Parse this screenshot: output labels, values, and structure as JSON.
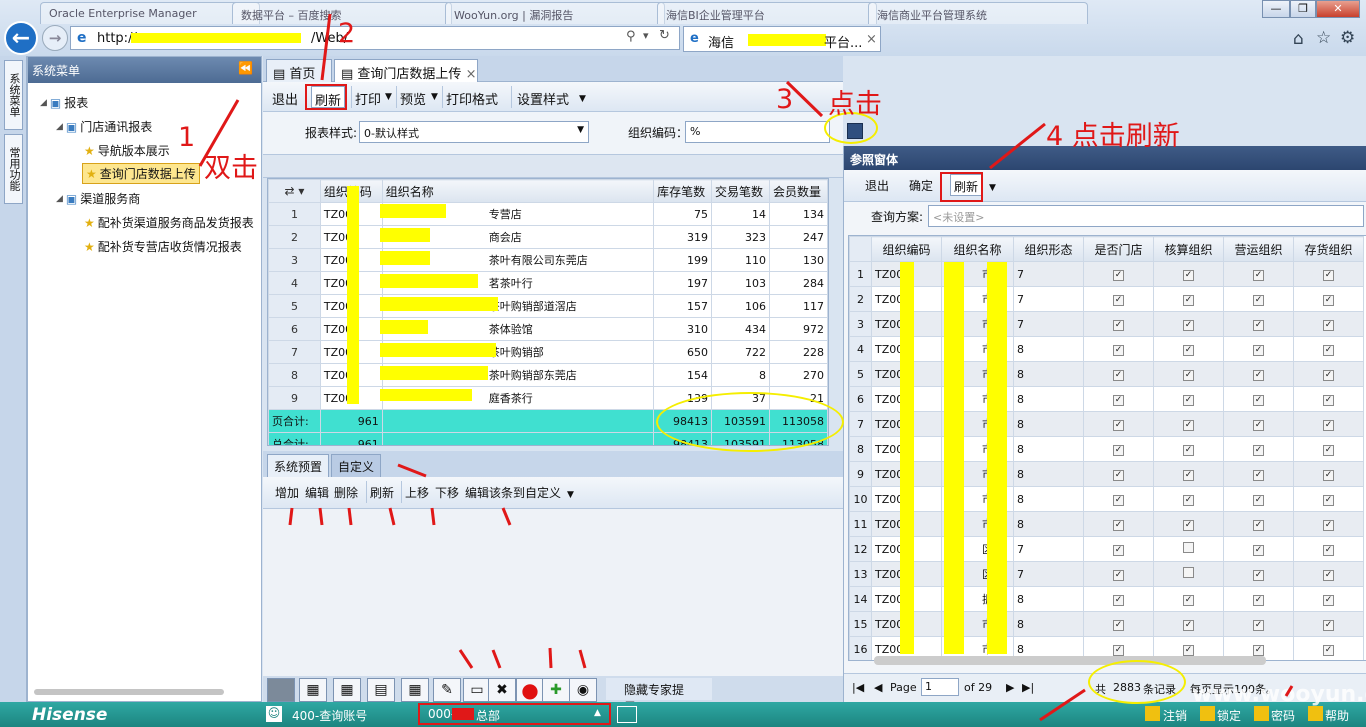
{
  "browser": {
    "tabs": [
      "Oracle Enterprise Manager",
      "数据平台 – 百度搜索",
      "WooYun.org | 漏洞报告",
      "海信BI企业管理平台",
      "海信商业平台管理系统"
    ],
    "address": "http://",
    "address_suffix": "/Web/",
    "active_tab": "海信",
    "active_tab_suffix": "平台...",
    "window_buttons": [
      "—",
      "❐",
      "✕"
    ]
  },
  "side_tabs": [
    "系统菜单",
    "常用功能"
  ],
  "left_panel": {
    "title": "系统菜单",
    "tree": [
      {
        "label": "报表",
        "level": 0
      },
      {
        "label": "门店通讯报表",
        "level": 1
      },
      {
        "label": "导航版本展示",
        "level": 2
      },
      {
        "label": "查询门店数据上传",
        "level": 2
      },
      {
        "label": "渠道服务商",
        "level": 1
      },
      {
        "label": "配补货渠道服务商品发货报表",
        "level": 2
      },
      {
        "label": "配补货专营店收货情况报表",
        "level": 2
      }
    ]
  },
  "main_tabs": [
    "首页",
    "查询门店数据上传"
  ],
  "toolbar": {
    "exit": "退出",
    "refresh": "刷新",
    "print": "打印",
    "preview": "预览",
    "print_format": "打印格式",
    "set_style": "设置样式"
  },
  "filter": {
    "style_label": "报表样式:",
    "style_value": "0-默认样式",
    "org_label": "组织编码：",
    "org_value": "%"
  },
  "report": {
    "columns": [
      "组织编码",
      "组织名称",
      "库存笔数",
      "交易笔数",
      "会员数量"
    ],
    "rows": [
      {
        "no": "1",
        "code": "TZ000",
        "name": "专营店",
        "stock": "75",
        "trade": "14",
        "member": "134"
      },
      {
        "no": "2",
        "code": "TZ000",
        "name": "商会店",
        "stock": "319",
        "trade": "323",
        "member": "247"
      },
      {
        "no": "3",
        "code": "TZ000",
        "name": "茶叶有限公司东莞店",
        "stock": "199",
        "trade": "110",
        "member": "130"
      },
      {
        "no": "4",
        "code": "TZ000",
        "name": "茗茶叶行",
        "stock": "197",
        "trade": "103",
        "member": "284"
      },
      {
        "no": "5",
        "code": "TZ000",
        "name": "茶叶购销部道滘店",
        "stock": "157",
        "trade": "106",
        "member": "117"
      },
      {
        "no": "6",
        "code": "TZ000",
        "name": "茶体验馆",
        "stock": "310",
        "trade": "434",
        "member": "972"
      },
      {
        "no": "7",
        "code": "TZ000",
        "name": "茶叶购销部",
        "stock": "650",
        "trade": "722",
        "member": "228"
      },
      {
        "no": "8",
        "code": "TZ000",
        "name": "茶叶购销部东莞店",
        "stock": "154",
        "trade": "8",
        "member": "270"
      },
      {
        "no": "9",
        "code": "TZ000",
        "name": "庭香茶行",
        "stock": "139",
        "trade": "37",
        "member": "21"
      }
    ],
    "page_total": {
      "label": "页合计:",
      "count": "961",
      "stock": "98413",
      "trade": "103591",
      "member": "113058"
    },
    "grand_total": {
      "label": "总合计:",
      "count": "961",
      "stock": "98413",
      "trade": "103591",
      "member": "113058"
    }
  },
  "lower": {
    "tabs": [
      "系统预置",
      "自定义"
    ],
    "buttons": [
      "增加",
      "编辑",
      "删除",
      "刷新",
      "上移",
      "下移",
      "编辑该条到自定义"
    ],
    "hide_expert": "隐藏专家提示"
  },
  "ref_window": {
    "title": "参照窗体",
    "buttons": [
      "退出",
      "确定",
      "刷新"
    ],
    "query_label": "查询方案:",
    "query_placeholder": "<未设置>",
    "columns": [
      "组织编码",
      "组织名称",
      "组织形态",
      "是否门店",
      "核算组织",
      "营运组织",
      "存货组织"
    ],
    "rows": [
      {
        "no": "1",
        "code": "TZ00",
        "name": "市",
        "form": "7",
        "checks": [
          true,
          true,
          true,
          true
        ]
      },
      {
        "no": "2",
        "code": "TZ00",
        "name": "市",
        "form": "7",
        "checks": [
          true,
          true,
          true,
          true
        ]
      },
      {
        "no": "3",
        "code": "TZ00",
        "name": "市",
        "form": "7",
        "checks": [
          true,
          true,
          true,
          true
        ]
      },
      {
        "no": "4",
        "code": "TZ00",
        "name": "市",
        "form": "8",
        "checks": [
          true,
          true,
          true,
          true
        ]
      },
      {
        "no": "5",
        "code": "TZ00",
        "name": "市",
        "form": "8",
        "checks": [
          true,
          true,
          true,
          true
        ]
      },
      {
        "no": "6",
        "code": "TZ00",
        "name": "市",
        "form": "8",
        "checks": [
          true,
          true,
          true,
          true
        ]
      },
      {
        "no": "7",
        "code": "TZ00",
        "name": "市",
        "form": "8",
        "checks": [
          true,
          true,
          true,
          true
        ]
      },
      {
        "no": "8",
        "code": "TZ00",
        "name": "市",
        "form": "8",
        "checks": [
          true,
          true,
          true,
          true
        ]
      },
      {
        "no": "9",
        "code": "TZ00",
        "name": "市",
        "form": "8",
        "checks": [
          true,
          true,
          true,
          true
        ]
      },
      {
        "no": "10",
        "code": "TZ00",
        "name": "市",
        "form": "8",
        "checks": [
          true,
          true,
          true,
          true
        ]
      },
      {
        "no": "11",
        "code": "TZ00",
        "name": "市",
        "form": "8",
        "checks": [
          true,
          true,
          true,
          true
        ]
      },
      {
        "no": "12",
        "code": "TZ00",
        "name": "区",
        "form": "7",
        "checks": [
          true,
          false,
          true,
          true
        ]
      },
      {
        "no": "13",
        "code": "TZ00",
        "name": "区",
        "form": "7",
        "checks": [
          true,
          false,
          true,
          true
        ]
      },
      {
        "no": "14",
        "code": "TZ00",
        "name": "振",
        "form": "8",
        "checks": [
          true,
          true,
          true,
          true
        ]
      },
      {
        "no": "15",
        "code": "TZ00",
        "name": "市",
        "form": "8",
        "checks": [
          true,
          true,
          true,
          true
        ]
      },
      {
        "no": "16",
        "code": "TZ00",
        "name": "市",
        "form": "8",
        "checks": [
          true,
          true,
          true,
          true
        ]
      }
    ],
    "pager": {
      "page_label": "Page",
      "page_value": "1",
      "of_label": "of 29",
      "total_prefix": "共",
      "total": "2883",
      "total_suffix": "条记录",
      "per_page": "每页显示100条。"
    }
  },
  "status": {
    "brand": "Hisense",
    "account": "400-查询账号",
    "org": "000-",
    "org_suffix": "总部",
    "logout": "注销",
    "lock": "锁定",
    "password": "密码",
    "help": "帮助"
  },
  "annotations": {
    "a1": "1",
    "a1_text": "双击",
    "a2": "2",
    "a3": "3",
    "a3_text": "点击",
    "a4": "4 点击刷新"
  },
  "watermark": "www.wooyun.org"
}
